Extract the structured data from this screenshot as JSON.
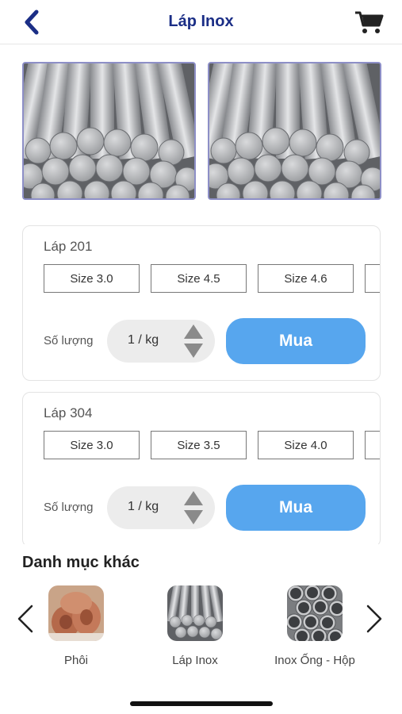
{
  "header": {
    "title": "Láp Inox",
    "back_icon": "chevron-left-icon",
    "cart_icon": "shopping-cart-icon",
    "accent_color": "#1b2e86"
  },
  "gallery": {
    "images": [
      {
        "icon": "steel-rods-image"
      },
      {
        "icon": "steel-rods-image"
      }
    ]
  },
  "products": [
    {
      "name": "Láp 201",
      "sizes": [
        "Size 3.0",
        "Size 4.5",
        "Size 4.6"
      ],
      "quantity_label": "Số lượng",
      "quantity_value": "1 / kg",
      "buy_label": "Mua"
    },
    {
      "name": "Láp 304",
      "sizes": [
        "Size 3.0",
        "Size 3.5",
        "Size 4.0"
      ],
      "quantity_label": "Số lượng",
      "quantity_value": "1 / kg",
      "buy_label": "Mua"
    }
  ],
  "buy_button_color": "#57a6ee",
  "other_categories": {
    "title": "Danh mục khác",
    "items": [
      {
        "label": "Phôi",
        "icon": "copper-billet-image"
      },
      {
        "label": "Láp Inox",
        "icon": "steel-rods-image"
      },
      {
        "label": "Inox Ống - Hộp",
        "icon": "steel-pipes-image"
      }
    ]
  }
}
